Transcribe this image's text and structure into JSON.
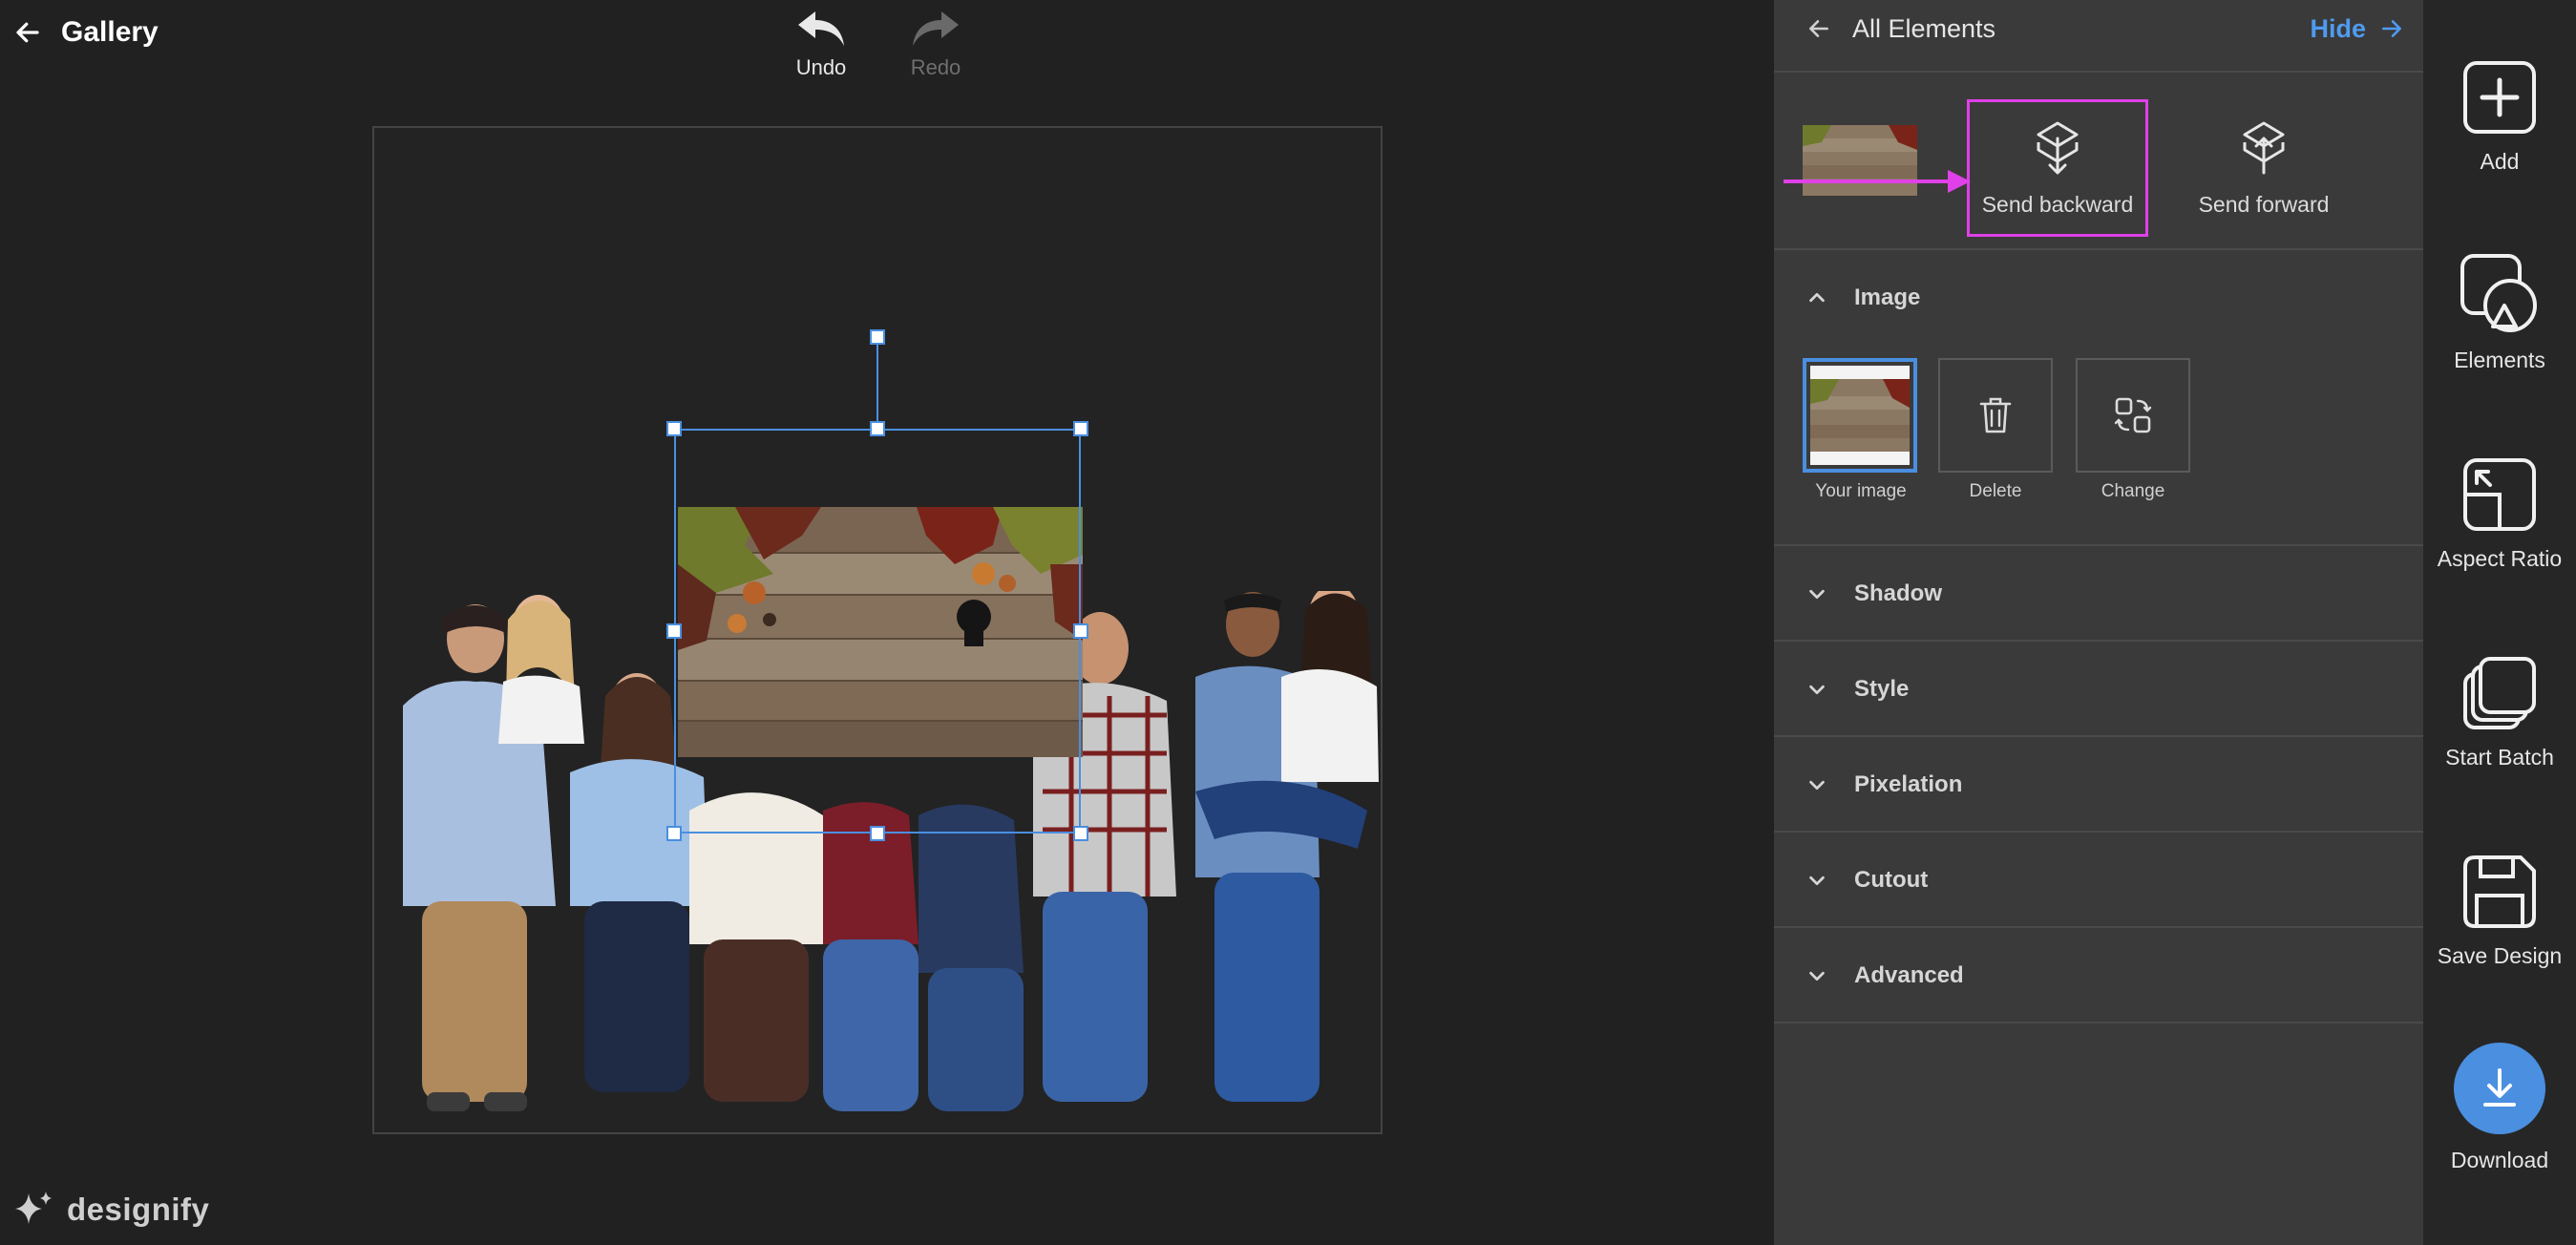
{
  "topbar": {
    "back_label": "Gallery",
    "undo_label": "Undo",
    "redo_label": "Redo"
  },
  "brand": {
    "name": "designify"
  },
  "panel": {
    "back_label": "All Elements",
    "hide_label": "Hide",
    "send_backward_label": "Send backward",
    "send_forward_label": "Send forward",
    "image_section": {
      "title": "Image",
      "your_image_label": "Your image",
      "delete_label": "Delete",
      "change_label": "Change"
    },
    "sections": [
      {
        "label": "Shadow"
      },
      {
        "label": "Style"
      },
      {
        "label": "Pixelation"
      },
      {
        "label": "Cutout"
      },
      {
        "label": "Advanced"
      }
    ]
  },
  "rail": {
    "items": [
      {
        "label": "Add",
        "icon": "plus-square-icon"
      },
      {
        "label": "Elements",
        "icon": "shapes-icon"
      },
      {
        "label": "Aspect Ratio",
        "icon": "aspect-ratio-icon"
      },
      {
        "label": "Start Batch",
        "icon": "stack-icon"
      },
      {
        "label": "Save Design",
        "icon": "floppy-disk-icon"
      },
      {
        "label": "Download",
        "icon": "download-icon"
      }
    ]
  },
  "colors": {
    "accent_blue": "#4a8fe0",
    "highlight_pink": "#e040e8",
    "background": "#212121",
    "panel": "#3a3a3a"
  }
}
